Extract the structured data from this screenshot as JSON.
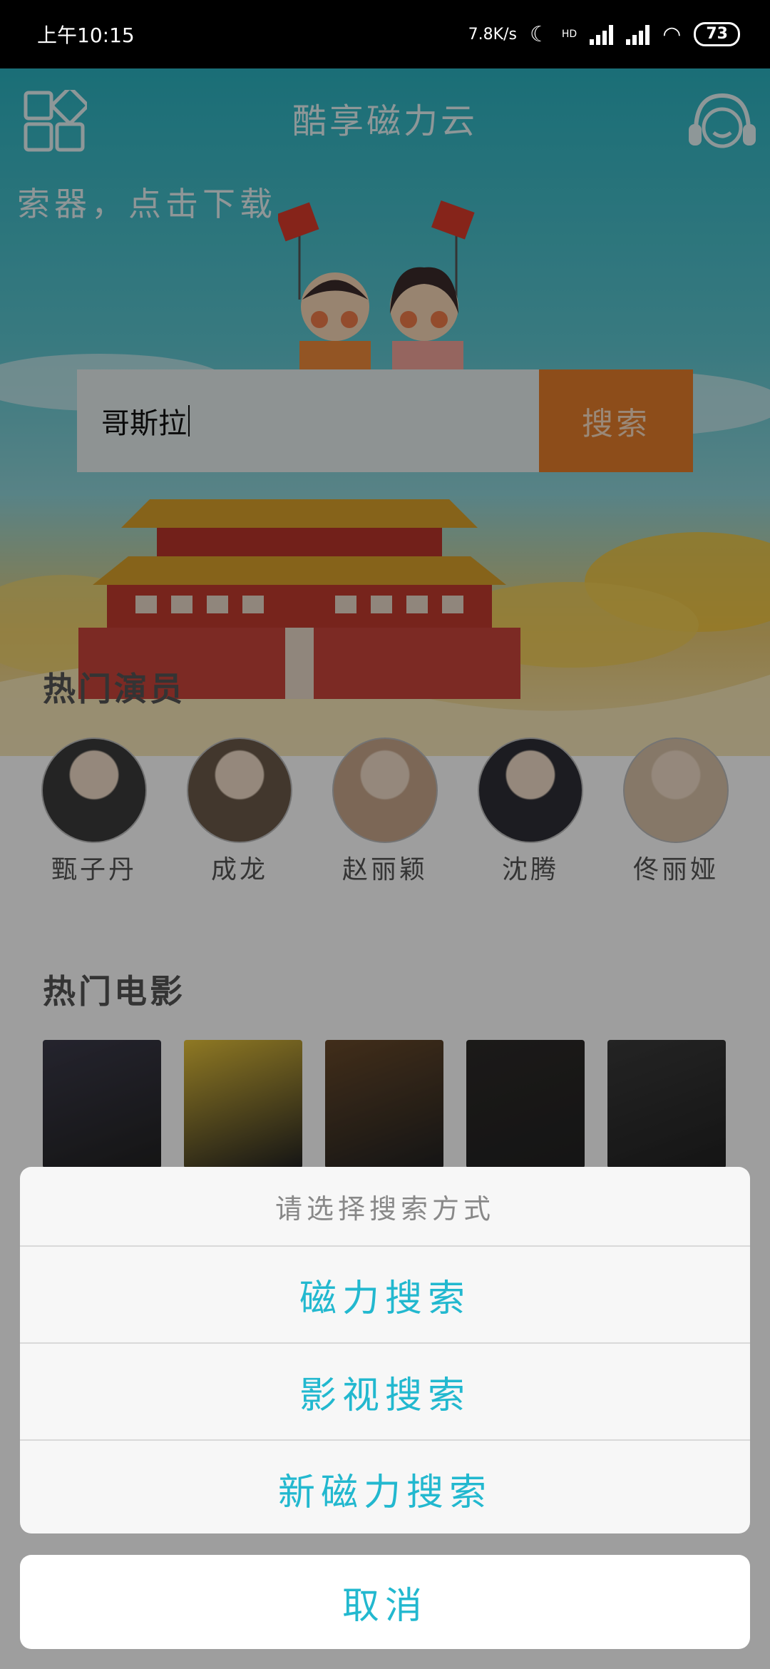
{
  "status_bar": {
    "time": "上午10:15",
    "net_speed": "7.8K/s",
    "hd_label": "HD",
    "battery": "73"
  },
  "header": {
    "title": "酷享磁力云",
    "menu_icon": "grid-icon",
    "service_icon": "headset-icon"
  },
  "marquee": "索器，点击下载",
  "search": {
    "query": "哥斯拉",
    "button_label": "搜索"
  },
  "actors": {
    "title": "热门演员",
    "items": [
      {
        "name": "甄子丹",
        "color": "#3a3a3a"
      },
      {
        "name": "成龙",
        "color": "#6b5a4a"
      },
      {
        "name": "赵丽颖",
        "color": "#c8a68c"
      },
      {
        "name": "沈腾",
        "color": "#2e2e36"
      },
      {
        "name": "佟丽娅",
        "color": "#d9c2a8"
      }
    ]
  },
  "movies": {
    "title": "热门电影",
    "posters": [
      "#3b3a4a",
      "#e7c33a",
      "#6a4a2a",
      "#2d2a28",
      "#3a3a3a"
    ]
  },
  "action_sheet": {
    "title": "请选择搜索方式",
    "options": [
      "磁力搜索",
      "影视搜索",
      "新磁力搜索"
    ],
    "cancel": "取消"
  },
  "colors": {
    "accent": "#22b8cf",
    "search_button": "#e47d2b"
  }
}
